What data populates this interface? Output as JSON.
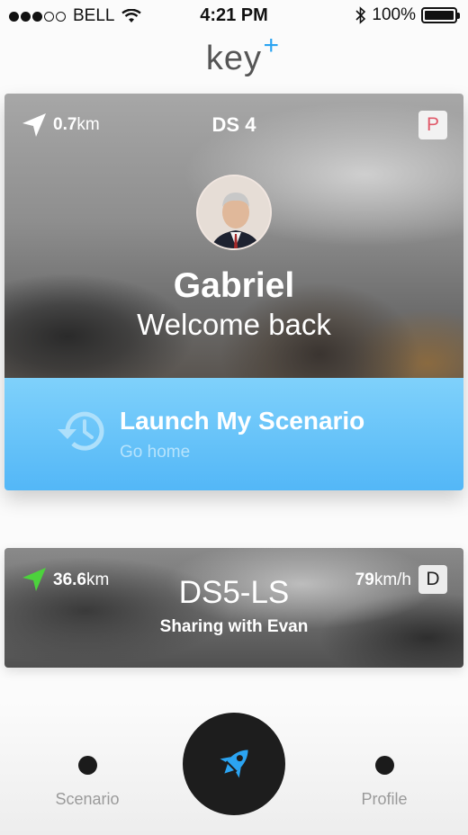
{
  "status_bar": {
    "carrier": "BELL",
    "time": "4:21 PM",
    "battery": "100%",
    "battery_level": 1.0,
    "signal_bars_filled": 3,
    "signal_bars_total": 5
  },
  "app": {
    "logo_text": "key",
    "logo_plus": "+",
    "accent_color": "#2ba4f2"
  },
  "main_card": {
    "distance_value": "0.7",
    "distance_unit": "km",
    "model": "DS 4",
    "gear": "P",
    "user_name": "Gabriel",
    "welcome": "Welcome back",
    "scenario_title": "Launch My Scenario",
    "scenario_subtitle": "Go home",
    "icons": {
      "navigation": "navigation-arrow-icon",
      "history": "history-icon"
    }
  },
  "second_card": {
    "distance_value": "36.6",
    "distance_unit": "km",
    "model": "DS5-LS",
    "sharing": "Sharing with Evan",
    "speed_value": "79",
    "speed_unit": "km/h",
    "gear": "D",
    "nav_color": "#4cd23c"
  },
  "tab_bar": {
    "left_label": "Scenario",
    "right_label": "Profile",
    "center_icon": "rocket-icon",
    "center_icon_color": "#2ba4f2"
  }
}
